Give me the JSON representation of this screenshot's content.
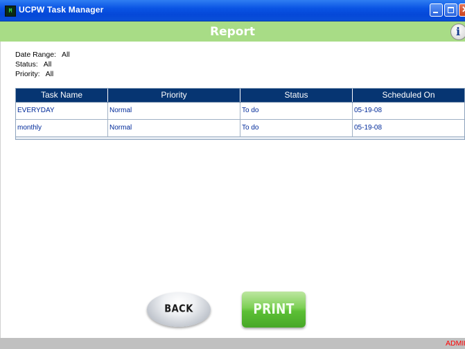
{
  "window": {
    "title": "UCPW Task Manager",
    "icon_label": "M"
  },
  "header": {
    "title": "Report",
    "info_icon": "i"
  },
  "filters": {
    "date_range_label": "Date Range:",
    "date_range_value": "All",
    "status_label": "Status:",
    "status_value": "All",
    "priority_label": "Priority:",
    "priority_value": "All"
  },
  "table": {
    "columns": [
      "Task Name",
      "Priority",
      "Status",
      "Scheduled On"
    ],
    "rows": [
      [
        "EVERYDAY",
        "Normal",
        "To do",
        "05-19-08"
      ],
      [
        "monthly",
        "Normal",
        "To do",
        "05-19-08"
      ]
    ]
  },
  "buttons": {
    "back_label": "BACK",
    "print_label": "PRINT"
  },
  "status": {
    "user": "ADMIN"
  },
  "colors": {
    "titlebar": "#0a54e4",
    "report_bar": "#a8dc86",
    "grid_header": "#063572",
    "grid_text": "#002a9a",
    "status_user": "#ff0000"
  }
}
